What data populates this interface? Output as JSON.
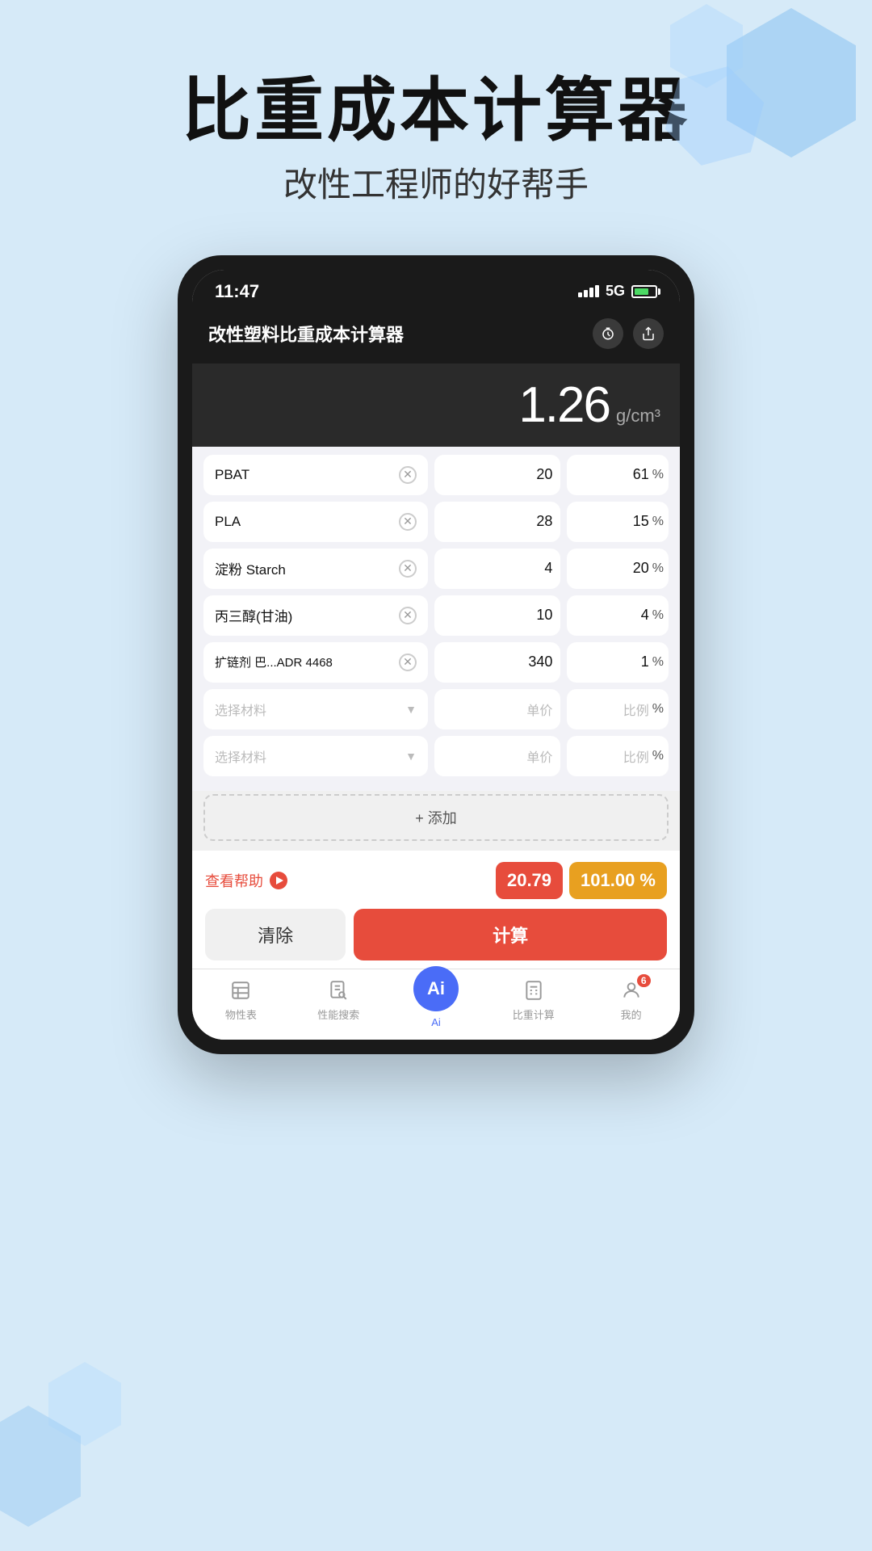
{
  "background_color": "#d6eaf8",
  "header": {
    "main_title": "比重成本计算器",
    "sub_title": "改性工程师的好帮手"
  },
  "status_bar": {
    "time": "11:47",
    "signal": "5G",
    "signal_strength": 4
  },
  "app": {
    "title": "改性塑料比重成本计算器",
    "result": {
      "value": "1.26",
      "unit": "g/cm³"
    },
    "ingredients": [
      {
        "name": "PBAT",
        "price": "20",
        "ratio": "61"
      },
      {
        "name": "PLA",
        "price": "28",
        "ratio": "15"
      },
      {
        "name": "淀粉 Starch",
        "price": "4",
        "ratio": "20"
      },
      {
        "name": "丙三醇(甘油)",
        "price": "10",
        "ratio": "4"
      },
      {
        "name": "扩链剂 巴...ADR 4468",
        "price": "340",
        "ratio": "1"
      }
    ],
    "empty_rows": [
      {
        "placeholder_material": "选择材料",
        "placeholder_price": "单价",
        "placeholder_ratio": "比例"
      },
      {
        "placeholder_material": "选择材料",
        "placeholder_price": "单价",
        "placeholder_ratio": "比例"
      }
    ],
    "add_button_label": "+ 添加",
    "help_label": "查看帮助",
    "cost_result": "20.79",
    "ratio_result": "101.00 %",
    "clear_button": "清除",
    "calc_button": "计算"
  },
  "tabs": [
    {
      "id": "properties",
      "label": "物性表",
      "icon": "table-icon"
    },
    {
      "id": "search",
      "label": "性能搜索",
      "icon": "search-doc-icon"
    },
    {
      "id": "ai",
      "label": "Ai",
      "icon": "ai-icon",
      "active": true
    },
    {
      "id": "density",
      "label": "比重计算",
      "icon": "calc-icon"
    },
    {
      "id": "mine",
      "label": "我的",
      "icon": "person-icon",
      "badge": "6"
    }
  ]
}
